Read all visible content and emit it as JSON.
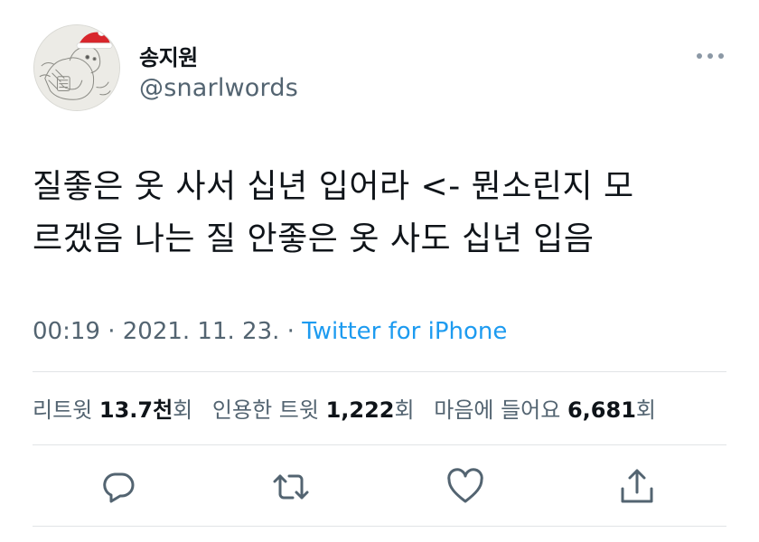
{
  "author": {
    "display_name": "송지원",
    "handle": "@snarlwords"
  },
  "tweet": {
    "text_line1": "질좋은 옷 사서 십년 입어라 <- 뭔소린지 모",
    "text_line2": "르겠음 나는 질 안좋은 옷 사도 십년 입음"
  },
  "meta": {
    "time": "00:19",
    "separator1": " · ",
    "date": "2021. 11. 23.",
    "separator2": " · ",
    "source": "Twitter for iPhone"
  },
  "stats": {
    "retweets_label": "리트윗 ",
    "retweets_count": "13.7천",
    "retweets_unit": "회",
    "quotes_label": "인용한 트윗 ",
    "quotes_count": "1,222",
    "quotes_unit": "회",
    "likes_label": "마음에 들어요 ",
    "likes_count": "6,681",
    "likes_unit": "회"
  },
  "icons": {
    "more": "more-dots-icon",
    "reply": "reply-icon",
    "retweet": "retweet-icon",
    "like": "heart-icon",
    "share": "share-icon"
  },
  "colors": {
    "link": "#1d9bf0",
    "secondary_text": "#536471",
    "primary_text": "#0f1419",
    "icon": "#536471"
  }
}
